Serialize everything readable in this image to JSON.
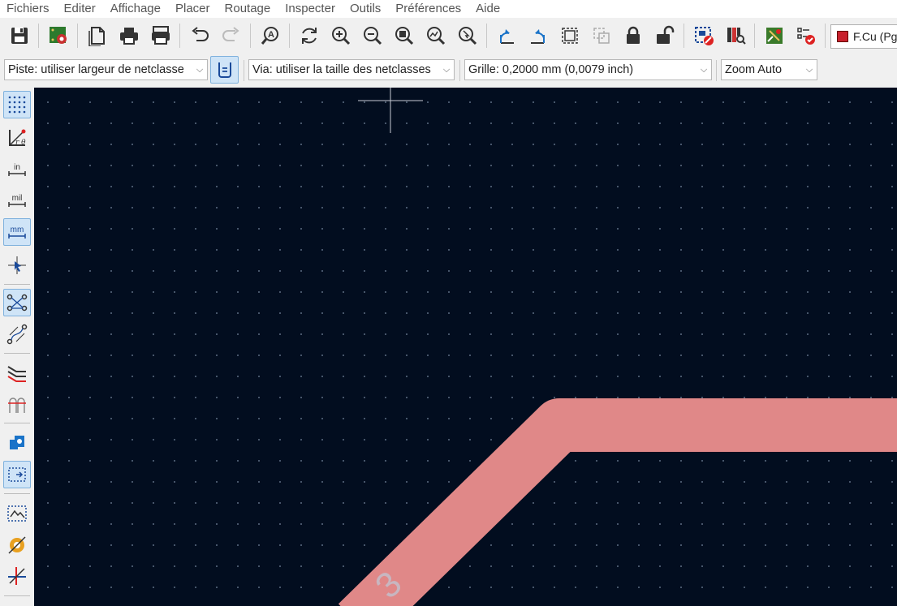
{
  "menu": {
    "items": [
      "Fichiers",
      "Editer",
      "Affichage",
      "Placer",
      "Routage",
      "Inspecter",
      "Outils",
      "Préférences",
      "Aide"
    ]
  },
  "toolbar": {
    "layer": {
      "label": "F.Cu (Pg",
      "color": "#c8202c"
    }
  },
  "toolbar2": {
    "track_width": "Piste: utiliser largeur de netclasse",
    "via_size": "Via: utiliser la taille des netclasses",
    "grid": "Grille: 0,2000 mm (0,0079 inch)",
    "zoom": "Zoom Auto"
  },
  "canvas": {
    "background": "#020d1f",
    "track_color": "#e08888",
    "track_net_label": "3"
  }
}
